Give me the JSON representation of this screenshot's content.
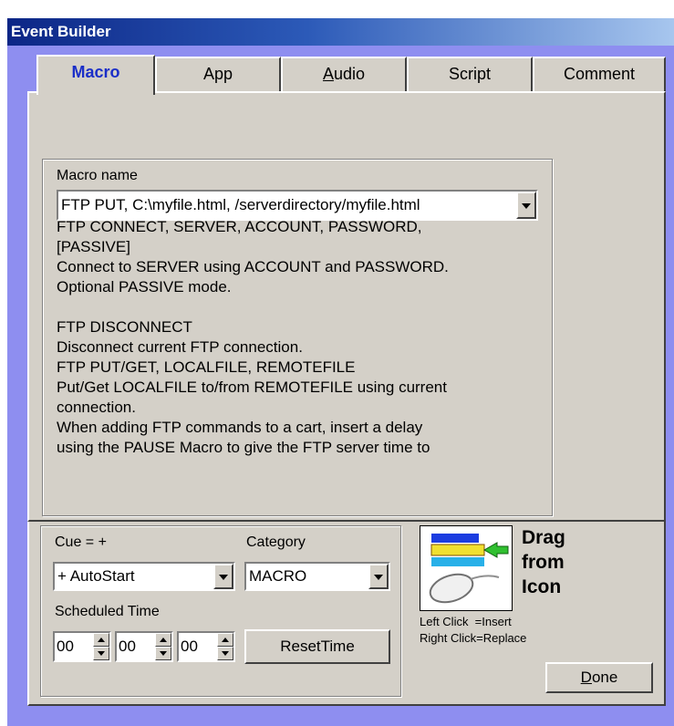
{
  "window": {
    "title": "Event Builder"
  },
  "tabs": [
    {
      "label": "Macro",
      "active": true
    },
    {
      "label": "App",
      "active": false
    },
    {
      "label_pre": "",
      "label_u": "A",
      "label_post": "udio",
      "active": false
    },
    {
      "label": "Script",
      "active": false
    },
    {
      "label": "Comment",
      "active": false
    }
  ],
  "macro": {
    "name_label": "Macro name",
    "name_value": "FTP PUT, C:\\myfile.html, /serverdirectory/myfile.html",
    "description": [
      "FTP CONNECT, SERVER, ACCOUNT, PASSWORD,",
      "[PASSIVE]",
      "Connect to SERVER using ACCOUNT and PASSWORD.",
      "Optional PASSIVE mode.",
      "",
      "FTP DISCONNECT",
      "Disconnect current FTP connection.",
      "FTP PUT/GET, LOCALFILE, REMOTEFILE",
      "Put/Get LOCALFILE to/from REMOTEFILE using current",
      "connection.",
      "When adding FTP commands to a cart, insert a delay",
      "using the PAUSE Macro to give the FTP server time to"
    ]
  },
  "cue": {
    "label": "Cue = +",
    "value": "+ AutoStart"
  },
  "category": {
    "label": "Category",
    "value": "MACRO"
  },
  "scheduled": {
    "label": "Scheduled Time",
    "hours": "00",
    "minutes": "00",
    "seconds": "00",
    "reset_label": "ResetTime"
  },
  "drag": {
    "title_line1": "Drag",
    "title_line2": "from",
    "title_line3": "Icon",
    "hint_left": "Left Click  =Insert",
    "hint_right": "Right Click=Replace"
  },
  "done": {
    "label_u": "D",
    "label_rest": "one"
  }
}
